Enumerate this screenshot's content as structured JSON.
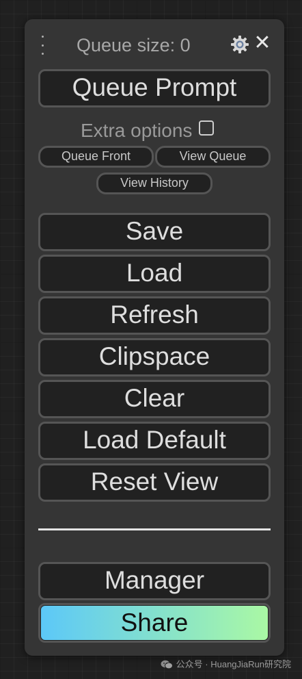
{
  "menu": {
    "queue_size_label": "Queue size: 0",
    "queue_prompt_label": "Queue Prompt",
    "extra_options_label": "Extra options",
    "extra_options_checked": false,
    "queue_front_label": "Queue Front",
    "view_queue_label": "View Queue",
    "view_history_label": "View History",
    "buttons": [
      {
        "label": "Save"
      },
      {
        "label": "Load"
      },
      {
        "label": "Refresh"
      },
      {
        "label": "Clipspace"
      },
      {
        "label": "Clear"
      },
      {
        "label": "Load Default"
      },
      {
        "label": "Reset View"
      }
    ],
    "manager_label": "Manager",
    "share_label": "Share",
    "share_gradient": [
      "#5cc8f8",
      "#aaf8a4"
    ],
    "icons": {
      "drag": "drag-handle-icon",
      "settings": "gear-icon",
      "close": "close-icon"
    }
  },
  "watermark": {
    "text": "公众号 · HuangJiaRun研究院",
    "icon": "wechat-icon"
  },
  "colors": {
    "background": "#202020",
    "panel": "#353535",
    "button_bg": "#212121",
    "button_border": "#555555",
    "button_text": "#dedede",
    "muted_text": "#a8a8a8"
  }
}
